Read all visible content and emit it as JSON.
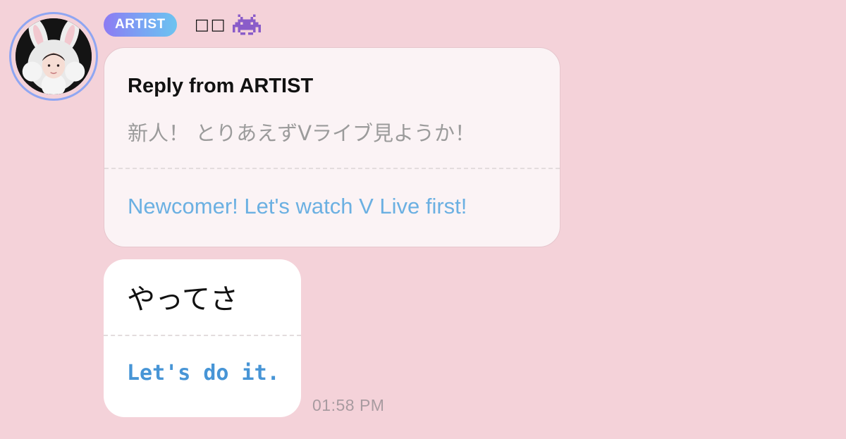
{
  "header": {
    "badge_label": "ARTIST",
    "name": "□□",
    "name_emoji_icon": "alien-monster-icon"
  },
  "reply": {
    "title": "Reply from ARTIST",
    "original_text": "新人！ とりあえずVライブ見ようか！",
    "translated_text": "Newcomer! Let's watch V Live first!"
  },
  "message": {
    "original_text": "やってさ",
    "translated_text": "Let's do it.",
    "timestamp": "01:58 PM"
  },
  "colors": {
    "background": "#f4d2d9",
    "badge_gradient_start": "#8d7bf3",
    "badge_gradient_end": "#6cc3f0",
    "translation_text": "#6bb0e2",
    "message_translation_text": "#4795d6",
    "avatar_ring": "#8fa6f2"
  }
}
